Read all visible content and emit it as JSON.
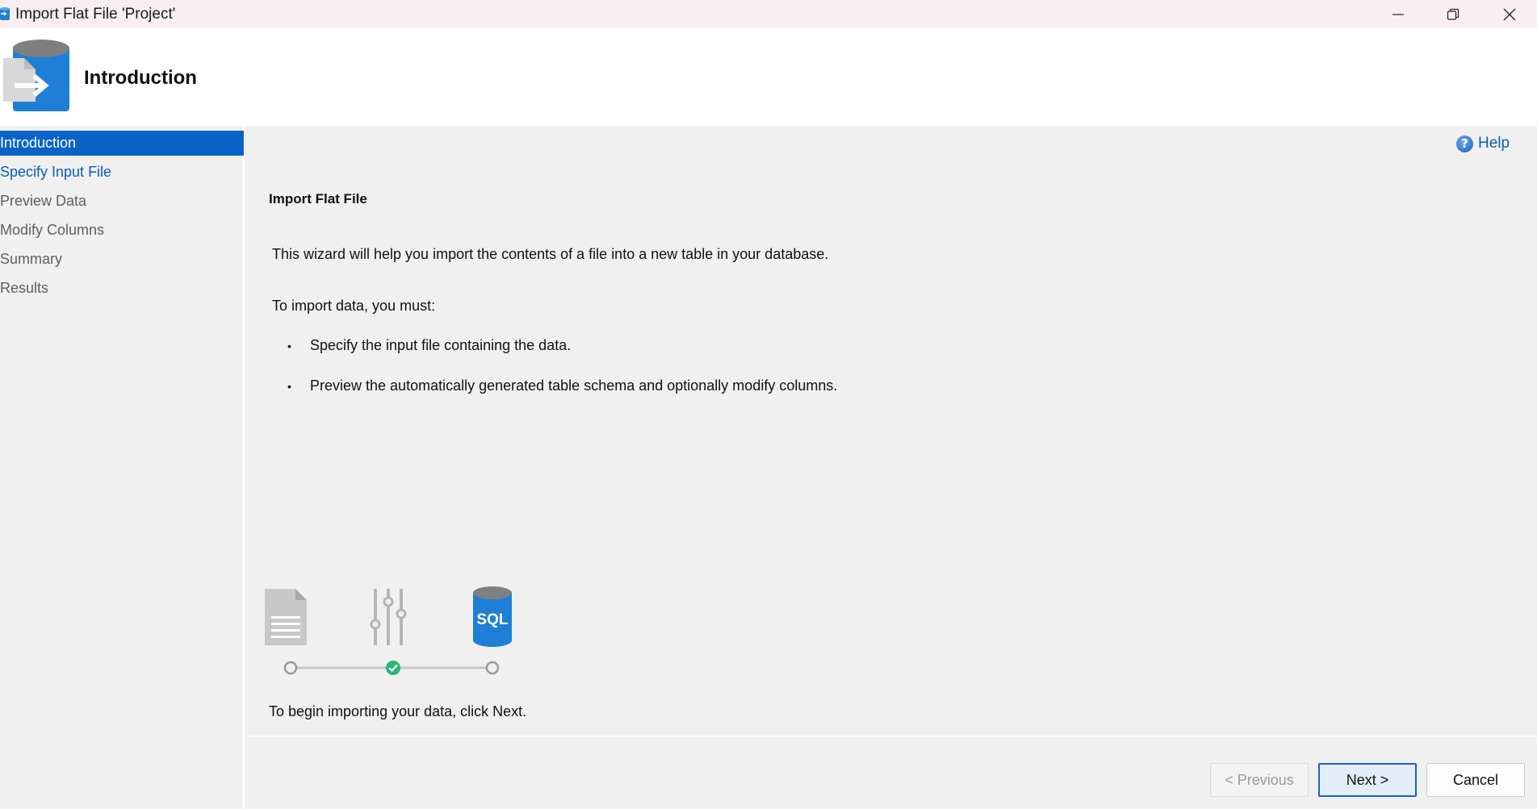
{
  "window": {
    "title": "Import Flat File 'Project'",
    "minimize_icon": "minimize-icon",
    "maximize_icon": "restore-icon",
    "close_icon": "close-icon"
  },
  "header": {
    "title": "Introduction",
    "icon": "import-database-icon"
  },
  "nav": {
    "items": [
      {
        "label": "Introduction",
        "state": "active"
      },
      {
        "label": "Specify Input File",
        "state": "link"
      },
      {
        "label": "Preview Data",
        "state": "disabled"
      },
      {
        "label": "Modify Columns",
        "state": "disabled"
      },
      {
        "label": "Summary",
        "state": "disabled"
      },
      {
        "label": "Results",
        "state": "disabled"
      }
    ]
  },
  "main": {
    "help_label": "Help",
    "section_title": "Import Flat File",
    "intro": "This wizard will help you import the contents of a file into a new table in your database.",
    "must_heading": "To import data, you must:",
    "bullets": [
      "Specify the input file containing the data.",
      "Preview the automatically generated table schema and optionally modify columns."
    ],
    "diagram": {
      "steps": [
        "file-icon",
        "sliders-icon",
        "sql-database-icon"
      ],
      "db_label": "SQL",
      "current_step": 2
    },
    "begin": "To begin importing your data, click Next."
  },
  "buttons": {
    "previous": "< Previous",
    "next": "Next >",
    "cancel": "Cancel"
  },
  "colors": {
    "accent": "#0a64c8",
    "link": "#0b5cb5",
    "check": "#2bb673"
  }
}
